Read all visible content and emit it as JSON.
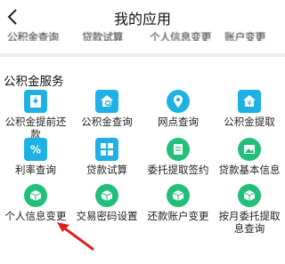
{
  "header": {
    "title": "我的应用"
  },
  "cut_row": [
    "公积金查询",
    "贷款试算",
    "个人信息变更",
    "账户变更"
  ],
  "section": {
    "title": "公积金服务"
  },
  "services": [
    {
      "label": "公积金提前还款",
      "icon": "bolt-document-icon",
      "color": "#1fb1e5"
    },
    {
      "label": "公积金查询",
      "icon": "house-search-icon",
      "color": "#1fb1e5"
    },
    {
      "label": "网点查询",
      "icon": "location-pin-icon",
      "color": "#1fb1e5"
    },
    {
      "label": "公积金提取",
      "icon": "yen-house-icon",
      "color": "#1fb1e5"
    },
    {
      "label": "利率查询",
      "icon": "percent-icon",
      "color": "#1fb1e5"
    },
    {
      "label": "贷款试算",
      "icon": "calculator-icon",
      "color": "#1fb1e5"
    },
    {
      "label": "委托提取签约",
      "icon": "sign-document-icon",
      "color": "#21c07a"
    },
    {
      "label": "贷款基本信息",
      "icon": "image-document-icon",
      "color": "#21c07a"
    },
    {
      "label": "个人信息变更",
      "icon": "cube-icon",
      "color": "#21c07a"
    },
    {
      "label": "交易密码设置",
      "icon": "cube-icon",
      "color": "#21c07a"
    },
    {
      "label": "还款账户变更",
      "icon": "cube-icon",
      "color": "#21c07a"
    },
    {
      "label": "按月委托提取息查询",
      "icon": "cube-icon",
      "color": "#21c07a"
    }
  ],
  "colors": {
    "accent_teal": "#1fb1e5",
    "accent_green": "#21c07a",
    "annotation_arrow": "#e02020"
  }
}
